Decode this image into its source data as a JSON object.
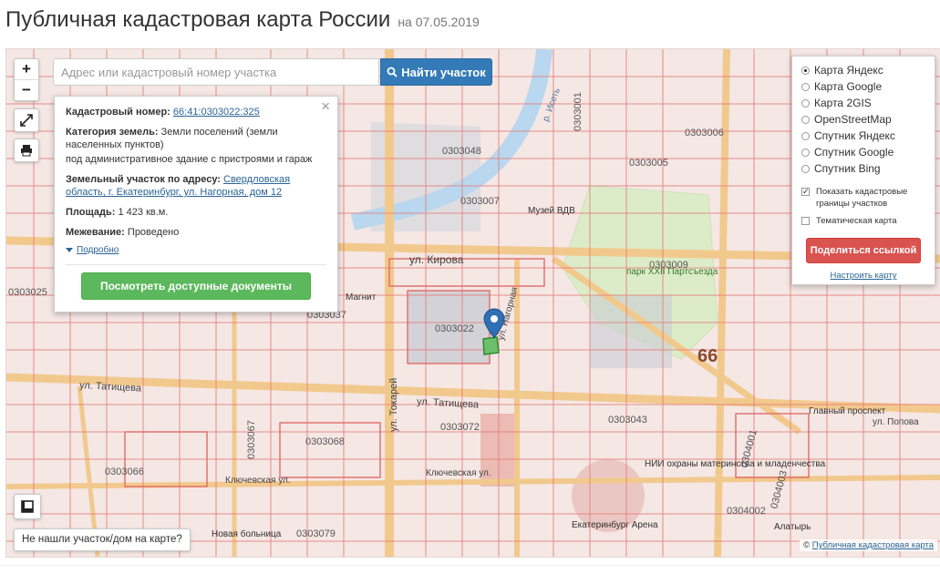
{
  "header": {
    "title": "Публичная кадастровая карта России",
    "date": "на 07.05.2019"
  },
  "search": {
    "placeholder": "Адрес или кадастровый номер участка",
    "button_label": "Найти участок"
  },
  "zoom": {
    "plus": "+",
    "minus": "−"
  },
  "info": {
    "cadastral_label": "Кадастровый номер:",
    "cadastral_value": "66:41:0303022:325",
    "category_label": "Категория земель:",
    "category_value": "Земли поселений (земли населенных пунктов)",
    "usage_value": "под административное здание с пристроями и гараж",
    "address_label": "Земельный участок по адресу:",
    "address_value": "Свердловская область, г. Екатеринбург, ул. Нагорная, дом 12",
    "area_label": "Площадь:",
    "area_value": "1 423 кв.м.",
    "survey_label": "Межевание:",
    "survey_value": "Проведено",
    "more_label": "Подробно",
    "docs_button": "Посмотреть доступные документы"
  },
  "layers": {
    "options": [
      {
        "label": "Карта Яндекс",
        "selected": true
      },
      {
        "label": "Карта Google",
        "selected": false
      },
      {
        "label": "Карта 2GIS",
        "selected": false
      },
      {
        "label": "OpenStreetMap",
        "selected": false
      },
      {
        "label": "Спутник Яндекс",
        "selected": false
      },
      {
        "label": "Спутник Google",
        "selected": false
      },
      {
        "label": "Спутник Bing",
        "selected": false
      }
    ],
    "show_borders_label": "Показать кадастровые границы участков",
    "show_borders_checked": true,
    "thematic_label": "Тематическая карта",
    "thematic_checked": false,
    "share_button": "Поделиться ссылкой",
    "config_link": "Настроить карту"
  },
  "map_labels": {
    "streets": [
      "ул. Кирова",
      "ул. Татищева",
      "ул. Татищева",
      "ул. Токарей",
      "Ключевская ул.",
      "Ключевская ул.",
      "ул. Нагорная",
      "ул. Попова",
      "р. Исеть"
    ],
    "quarters": [
      "0303022",
      "0303007",
      "0303005",
      "0303006",
      "0303009",
      "0303072",
      "0303068",
      "0303066",
      "0303043",
      "0303079",
      "0303001",
      "0303048",
      "0303067",
      "0303037",
      "0303025",
      "0304001",
      "0304002",
      "0304003"
    ],
    "places": [
      "Музей ВДВ",
      "парк XXII Партсъезда",
      "Магнит",
      "НИИ охраны материнства и младенчества",
      "Екатеринбург Арена",
      "Новая больница",
      "Главный проспект",
      "Алатырь",
      "66"
    ]
  },
  "not_found_label": "Не нашли участок/дом на карте?",
  "attribution": {
    "symbol": "©",
    "link": "Публичная кадастровая карта"
  }
}
